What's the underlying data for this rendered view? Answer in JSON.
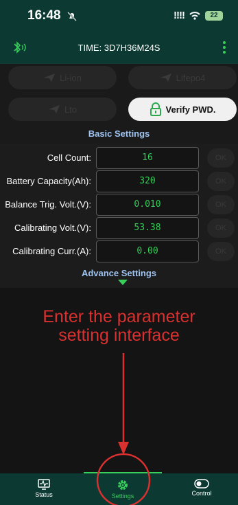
{
  "status_bar": {
    "time": "16:48",
    "signal": "!!!!",
    "battery": "22"
  },
  "header": {
    "title": "TIME: 3D7H36M24S"
  },
  "battery_types": [
    {
      "label": "Li-ion"
    },
    {
      "label": "Lifepo4"
    },
    {
      "label": "Lto"
    }
  ],
  "verify_button": {
    "label": "Verify PWD."
  },
  "basic_settings": {
    "title": "Basic Settings",
    "rows": [
      {
        "label": "Cell Count:",
        "value": "16",
        "ok": "OK"
      },
      {
        "label": "Battery Capacity(Ah):",
        "value": "320",
        "ok": "OK"
      },
      {
        "label": "Balance Trig. Volt.(V):",
        "value": "0.010",
        "ok": "OK"
      },
      {
        "label": "Calibrating Volt.(V):",
        "value": "53.38",
        "ok": "OK"
      },
      {
        "label": "Calibrating Curr.(A):",
        "value": "0.00",
        "ok": "OK"
      }
    ]
  },
  "advance_settings": {
    "title": "Advance Settings"
  },
  "annotation": {
    "line1": "Enter the parameter",
    "line2": "setting interface"
  },
  "tabs": [
    {
      "label": "Status"
    },
    {
      "label": "Settings"
    },
    {
      "label": "Control"
    }
  ],
  "colors": {
    "accent": "#38d05a",
    "header": "#0c3a33",
    "annotation": "#d93030",
    "section_title": "#9fc4f0"
  }
}
